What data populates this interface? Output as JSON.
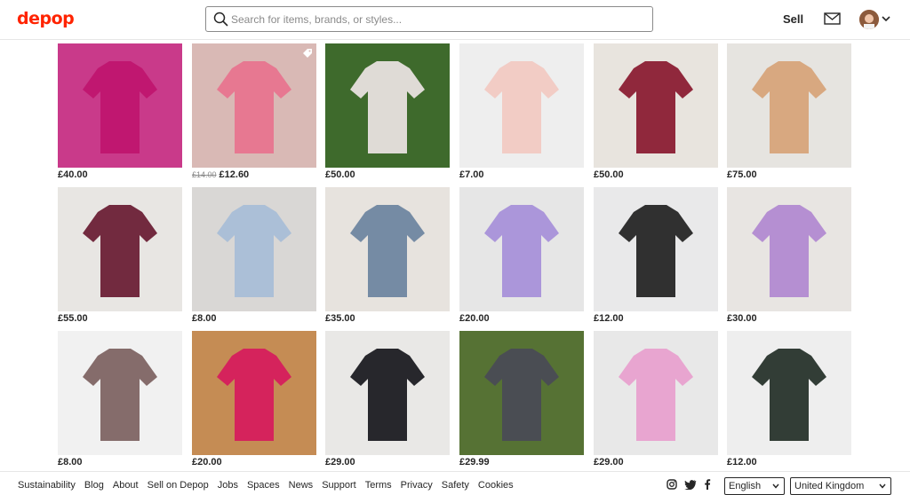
{
  "header": {
    "logo": "depop",
    "search_placeholder": "Search for items, brands, or styles...",
    "sell_label": "Sell",
    "icons": [
      "search-icon",
      "mail-icon",
      "avatar",
      "chevron-down-icon"
    ]
  },
  "products": [
    {
      "price": "£40.00",
      "bg": "#c93a8a",
      "item": "#c0156f"
    },
    {
      "old_price": "£14.00",
      "price": "£12.60",
      "bg": "#d9b9b5",
      "item": "#e8748f"
    },
    {
      "price": "£50.00",
      "bg": "#3e6a2c",
      "item": "#e8e2df"
    },
    {
      "price": "£7.00",
      "bg": "#eeeeee",
      "item": "#f1c9c2"
    },
    {
      "price": "£50.00",
      "bg": "#e8e4de",
      "item": "#8b1d33"
    },
    {
      "price": "£75.00",
      "bg": "#e6e4e0",
      "item": "#d7a47a"
    },
    {
      "price": "£55.00",
      "bg": "#e8e6e3",
      "item": "#6b2036"
    },
    {
      "price": "£8.00",
      "bg": "#d9d7d5",
      "item": "#a9bed7"
    },
    {
      "price": "£35.00",
      "bg": "#e7e3de",
      "item": "#6f86a0"
    },
    {
      "price": "£20.00",
      "bg": "#e6e6e6",
      "item": "#a891d9"
    },
    {
      "price": "£12.00",
      "bg": "#e9e9ea",
      "item": "#262626"
    },
    {
      "price": "£30.00",
      "bg": "#e8e5e2",
      "item": "#b28ad1"
    },
    {
      "price": "£8.00",
      "bg": "#f1f1f1",
      "item": "#7e6463"
    },
    {
      "price": "£20.00",
      "bg": "#c58c54",
      "item": "#d61d5d"
    },
    {
      "price": "£29.00",
      "bg": "#e9e8e6",
      "item": "#1c1c22"
    },
    {
      "price": "£29.99",
      "bg": "#567234",
      "item": "#4a4b55"
    },
    {
      "price": "£29.00",
      "bg": "#e8e8e8",
      "item": "#e8a1cf"
    },
    {
      "price": "£12.00",
      "bg": "#eeeeee",
      "item": "#27332b"
    }
  ],
  "footer": {
    "links": [
      "Sustainability",
      "Blog",
      "About",
      "Sell on Depop",
      "Jobs",
      "Spaces",
      "News",
      "Support",
      "Terms",
      "Privacy",
      "Safety",
      "Cookies"
    ],
    "social_icons": [
      "instagram-icon",
      "twitter-icon",
      "facebook-icon"
    ],
    "language": "English",
    "region": "United Kingdom"
  },
  "colors": {
    "brand": "#ff2300",
    "text": "#262626",
    "border": "#e6e6e6"
  }
}
